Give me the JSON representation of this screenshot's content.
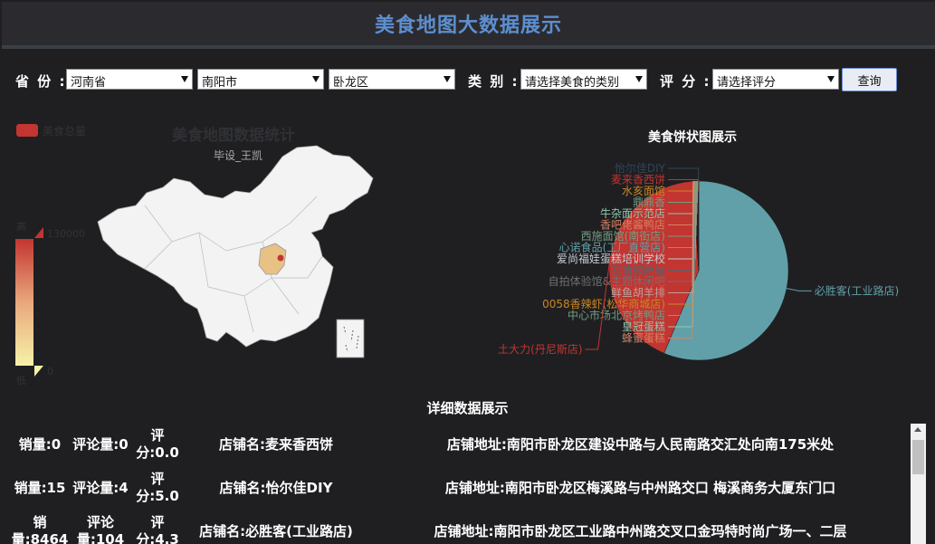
{
  "header": {
    "title": "美食地图大数据展示"
  },
  "filters": {
    "province_label": "省 份 :",
    "province_value": "河南省",
    "city_value": "南阳市",
    "district_value": "卧龙区",
    "category_label": "类 别 :",
    "category_value": "请选择美食的类别",
    "score_label": "评 分 :",
    "score_value": "请选择评分",
    "query_button": "查询"
  },
  "map": {
    "legend_label": "美食总量",
    "title": "美食地图数据统计",
    "subtitle": "毕设_王凯",
    "visual_map": {
      "high_label": "高",
      "low_label": "低",
      "max": "130000",
      "min": "0"
    },
    "highlight_color": "#e8c185",
    "marker_color": "#c23531"
  },
  "pie": {
    "title": "美食饼状图展示"
  },
  "chart_data": {
    "type": "pie",
    "title": "美食饼状图展示",
    "slices": [
      {
        "name": "必胜客(工业路店)",
        "value": 8464,
        "color": "#61a0a8"
      },
      {
        "name": "土大力(丹尼斯店)",
        "value": 6400,
        "color": "#c23531"
      },
      {
        "name": "蜂蜜蛋糕",
        "value": 10,
        "color": "#d48265"
      },
      {
        "name": "皇冠蛋糕",
        "value": 10,
        "color": "#91c7ae"
      },
      {
        "name": "中心市场北京烤鸭店",
        "value": 10,
        "color": "#749f83"
      },
      {
        "name": "0058香辣虾(松华商城店)",
        "value": 10,
        "color": "#ca8622"
      },
      {
        "name": "鲜鱼胡羊排",
        "value": 10,
        "color": "#bda29a"
      },
      {
        "name": "自拍体验馆&主题休闲吧",
        "value": 10,
        "color": "#6e7074"
      },
      {
        "name": "友情披萨屋",
        "value": 10,
        "color": "#546570"
      },
      {
        "name": "爱尚福娃蛋糕培训学校",
        "value": 10,
        "color": "#c4ccd3"
      },
      {
        "name": "心诺食品(工厂直营店)",
        "value": 10,
        "color": "#61a0a8"
      },
      {
        "name": "西施面馆(南街店)",
        "value": 10,
        "color": "#749f83"
      },
      {
        "name": "香吧佬酱鸭店",
        "value": 10,
        "color": "#d48265"
      },
      {
        "name": "牛杂面示范店",
        "value": 10,
        "color": "#91c7ae"
      },
      {
        "name": "鼎鼎香",
        "value": 10,
        "color": "#749f83"
      },
      {
        "name": "水亥面馆",
        "value": 10,
        "color": "#ca8622"
      },
      {
        "name": "麦来香西饼",
        "value": 5,
        "color": "#c23531"
      },
      {
        "name": "怡尔佳DIY",
        "value": 15,
        "color": "#2f4554"
      }
    ]
  },
  "detail": {
    "title": "详细数据展示",
    "rows": [
      {
        "sales": "销量:0",
        "comments": "评论量:0",
        "score": "评分:0.0",
        "shop": "店铺名:麦来香西饼",
        "address": "店铺地址:南阳市卧龙区建设中路与人民南路交汇处向南175米处"
      },
      {
        "sales": "销量:15",
        "comments": "评论量:4",
        "score": "评分:5.0",
        "shop": "店铺名:怡尔佳DIY",
        "address": "店铺地址:南阳市卧龙区梅溪路与中州路交口 梅溪商务大厦东门口"
      },
      {
        "sales": "销量:8464",
        "comments": "评论量:104",
        "score": "评分:4.3",
        "shop": "店铺名:必胜客(工业路店)",
        "address": "店铺地址:南阳市卧龙区工业路中州路交叉口金玛特时尚广场一、二层"
      }
    ]
  }
}
